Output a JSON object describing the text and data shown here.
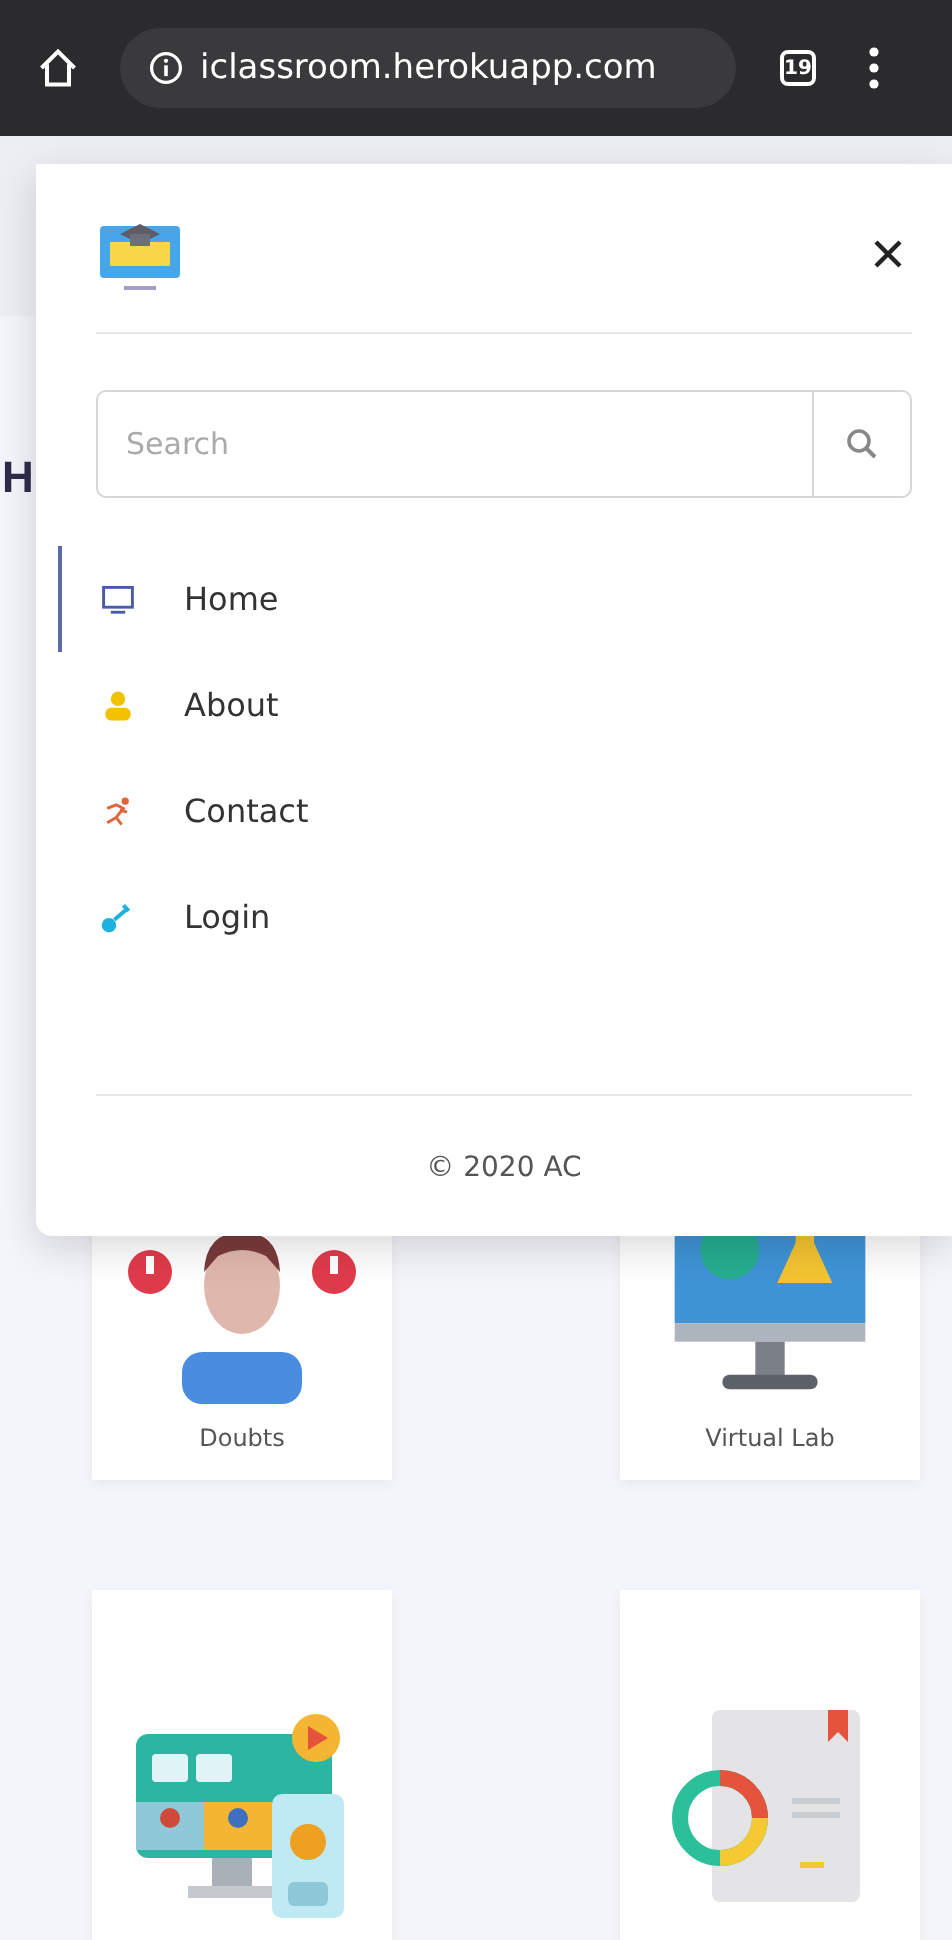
{
  "browser": {
    "url": "iclassroom.herokuapp.com",
    "tab_count": "19"
  },
  "page": {
    "heading": "H",
    "cards": [
      {
        "kind": "doubts",
        "label": "Doubts"
      },
      {
        "kind": "lab",
        "label": "Virtual Lab"
      },
      {
        "kind": "video"
      },
      {
        "kind": "report"
      }
    ]
  },
  "drawer": {
    "search": {
      "placeholder": "Search"
    },
    "items": [
      {
        "kind": "monitor",
        "label": "Home",
        "selected": true
      },
      {
        "kind": "person",
        "label": "About",
        "selected": false
      },
      {
        "kind": "runner",
        "label": "Contact",
        "selected": false
      },
      {
        "kind": "key",
        "label": "Login",
        "selected": false
      }
    ],
    "footer": "© 2020 AC"
  }
}
